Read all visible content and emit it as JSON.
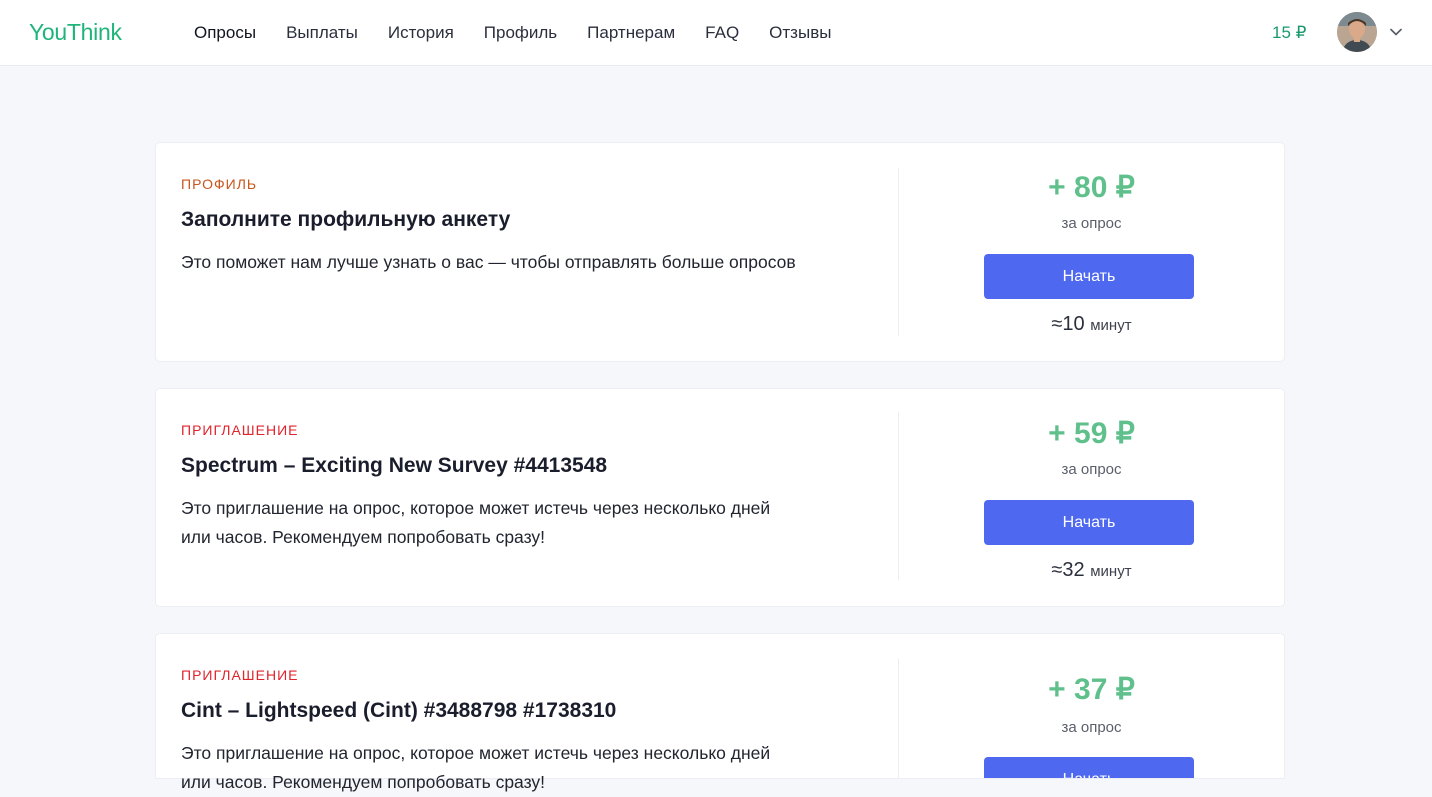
{
  "header": {
    "logo": "YouThink",
    "nav": [
      {
        "label": "Опросы",
        "active": true
      },
      {
        "label": "Выплаты"
      },
      {
        "label": "История"
      },
      {
        "label": "Профиль"
      },
      {
        "label": "Партнерам"
      },
      {
        "label": "FAQ"
      },
      {
        "label": "Отзывы"
      }
    ],
    "balance": "15 ₽",
    "avatar_icon": "user-avatar",
    "menu_icon": "chevron-down-icon"
  },
  "surveys": [
    {
      "tag": "ПРОФИЛЬ",
      "title": "Заполните профильную анкету",
      "description": "Это поможет нам лучше узнать о вас — чтобы отправлять больше опросов",
      "reward": "+ 80 ₽",
      "per_survey": "за опрос",
      "button": "Начать",
      "duration_value": "≈10",
      "duration_unit": "минут"
    },
    {
      "tag": "ПРИГЛАШЕНИЕ",
      "title": "Spectrum – Exciting New Survey #4413548",
      "description": "Это приглашение на опрос, которое может истечь через несколько дней или часов. Рекомендуем попробовать сразу!",
      "reward": "+ 59 ₽",
      "per_survey": "за опрос",
      "button": "Начать",
      "duration_value": "≈32",
      "duration_unit": "минут"
    },
    {
      "tag": "ПРИГЛАШЕНИЕ",
      "title": "Cint – Lightspeed (Cint) #3488798 #1738310",
      "description": "Это приглашение на опрос, которое может истечь через несколько дней или часов. Рекомендуем попробовать сразу!",
      "reward": "+ 37 ₽",
      "per_survey": "за опрос",
      "button": "Начать"
    }
  ],
  "colors": {
    "brand": "#1fb57a",
    "reward": "#5fc08c",
    "button": "#4e68f0",
    "tag_profile": "#c7561d",
    "tag_invite": "#e0232c"
  }
}
